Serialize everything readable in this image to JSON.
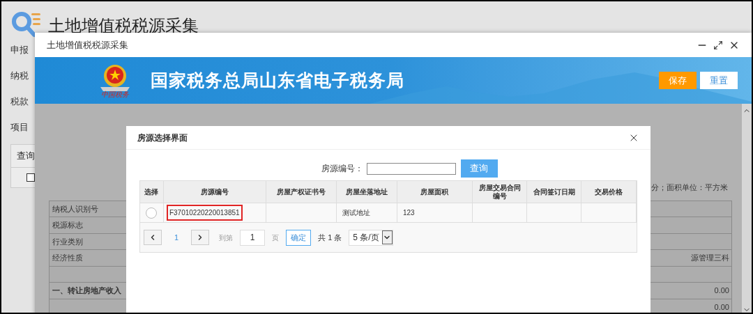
{
  "page": {
    "title": "土地增值税税源采集",
    "labels": [
      "申报",
      "纳税",
      "税款",
      "项目"
    ],
    "query_label": "查询",
    "query_checkbox": {
      "checked": false
    }
  },
  "window": {
    "title": "土地增值税税源采集",
    "emblem_caption": "中国税务",
    "banner_title": "国家税务总局山东省电子税务局",
    "buttons": [
      {
        "label": "保存",
        "kind": "primary"
      },
      {
        "label": "重置",
        "kind": "secondary"
      }
    ],
    "unit_note": "分；面积单位：平方米",
    "form_rows": [
      {
        "label": "纳税人识别号",
        "value": "",
        "kind": "field"
      },
      {
        "label": "税源标志",
        "value": "",
        "kind": "field"
      },
      {
        "label": "行业类别",
        "value": "",
        "kind": "field"
      },
      {
        "label": "经济性质",
        "value": "源管理三科",
        "kind": "field"
      },
      {
        "label": "",
        "value": "",
        "kind": "field"
      },
      {
        "label": "一、转让房地产收入",
        "value": "0.00",
        "kind": "section"
      },
      {
        "label": "",
        "value": "0.00",
        "kind": "field"
      }
    ]
  },
  "dialog": {
    "title": "房源选择界面",
    "search": {
      "label": "房源编号：",
      "button": "查询"
    },
    "columns": [
      "选择",
      "房源编号",
      "房屋产权证书号",
      "房屋坐落地址",
      "房屋面积",
      "房屋交易合同编号",
      "合同签订日期",
      "交易价格"
    ],
    "rows": [
      {
        "selected": false,
        "cells": [
          "",
          {
            "text": "F37010220220013851",
            "outlined": true
          },
          "",
          "测试地址",
          "123",
          "",
          "",
          ""
        ]
      }
    ],
    "pagination": {
      "current_page": "1",
      "goto_label": "到第",
      "goto_value": "1",
      "page_unit": "页",
      "confirm": "确定",
      "total": "共 1 条",
      "page_size": "5 条/页"
    }
  }
}
